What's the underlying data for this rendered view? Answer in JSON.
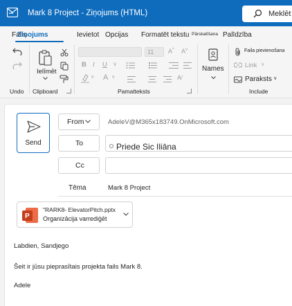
{
  "titlebar": {
    "title": "Mark 8 Project - Ziņojums (HTML)",
    "search_label": "Meklēt"
  },
  "menu": {
    "items": [
      {
        "label": "Fails"
      },
      {
        "label": "Ziņojums"
      },
      {
        "label": "Ievietot"
      },
      {
        "label": "Opcijas"
      },
      {
        "label": "Formatēt tekstu"
      },
      {
        "label": "Pārskatīšana"
      },
      {
        "label": "Palīdzība"
      }
    ],
    "active": "Ziņojums"
  },
  "ribbon": {
    "groups": {
      "undo": "Undo",
      "clipboard": "Clipboard",
      "basic_text": "Pamatteksts",
      "include": "Include"
    },
    "paste_label": "Ielīmēt",
    "font_size": "11",
    "names_label": "Names",
    "attach_label": "Faila pievienošana",
    "link_label": "Link",
    "signature_label": "Paraksts"
  },
  "compose": {
    "send_label": "Send",
    "from_label": "From",
    "from_address": "AdeleV@M365x183749.OnMicrosoft.com",
    "to_label": "To",
    "to_recipient": "Priede Sic Iliāna",
    "cc_label": "Cc",
    "subject_label": "Tēma",
    "subject_value": "Mark 8 Project"
  },
  "attachment": {
    "name": "\"RARK8- ElevatorPitch.pptx",
    "subtitle": "Organizācija varrediģēt"
  },
  "body": {
    "greeting": "Labdien, Sandjego",
    "message": "Šeit ir jūsu pieprasītais projekta fails Mark 8.",
    "signature": "Adele"
  },
  "colors": {
    "accent": "#0f6cbd",
    "ribbon_bg": "#f5f5f5",
    "ppt_red": "#c43e1c"
  }
}
